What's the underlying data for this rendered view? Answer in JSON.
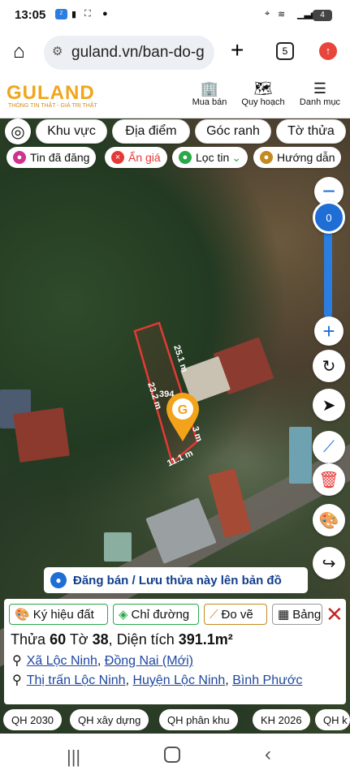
{
  "status": {
    "time": "13:05",
    "battery": "4"
  },
  "browser": {
    "url": "guland.vn/ban-do-g",
    "tab_count": "5"
  },
  "app": {
    "logo": "GULAND",
    "tagline": "THÔNG TIN THẬT - GIÁ TRỊ THẬT",
    "nav": [
      {
        "label": "Mua bán",
        "icon": "building-icon"
      },
      {
        "label": "Quy hoạch",
        "icon": "map-search-icon"
      },
      {
        "label": "Danh mục",
        "icon": "menu-icon"
      }
    ]
  },
  "filters": {
    "row1": [
      "Khu vực",
      "Địa điểm",
      "Góc ranh",
      "Tờ thửa"
    ],
    "row2": [
      {
        "label": "Tin đã đăng",
        "color": "#d0328e"
      },
      {
        "label": "Ẩn giá",
        "color": "#e53935"
      },
      {
        "label": "Lọc tin",
        "color": "#2aa94a"
      },
      {
        "label": "Hướng dẫn",
        "color": "#c58a1f"
      }
    ]
  },
  "map": {
    "zoom_value": "0",
    "dims": [
      "25.1 m",
      "23.2 m",
      "11.1 m",
      "3 m"
    ],
    "area_label": "394"
  },
  "banner": {
    "text": "Đăng bán / Lưu thửa này lên bản đồ"
  },
  "panel": {
    "tools": [
      "Ký hiệu đất",
      "Chỉ đường",
      "Đo vẽ",
      "Bảng"
    ],
    "parcel": {
      "thua_label": "Thửa",
      "thua": "60",
      "to_label": "Tờ",
      "to": "38",
      "area_label": "Diện tích",
      "area": "391.1m²"
    },
    "addr1": {
      "a": "Xã Lộc Ninh",
      "b": "Đồng Nai (Mới)"
    },
    "addr2": {
      "a": "Thị trấn Lộc Ninh",
      "b": "Huyện Lộc Ninh",
      "c": "Bình Phước"
    }
  },
  "qh_tabs": [
    "QH 2030",
    "QH xây dựng",
    "QH phân khu",
    "KH 2026",
    "QH k"
  ]
}
